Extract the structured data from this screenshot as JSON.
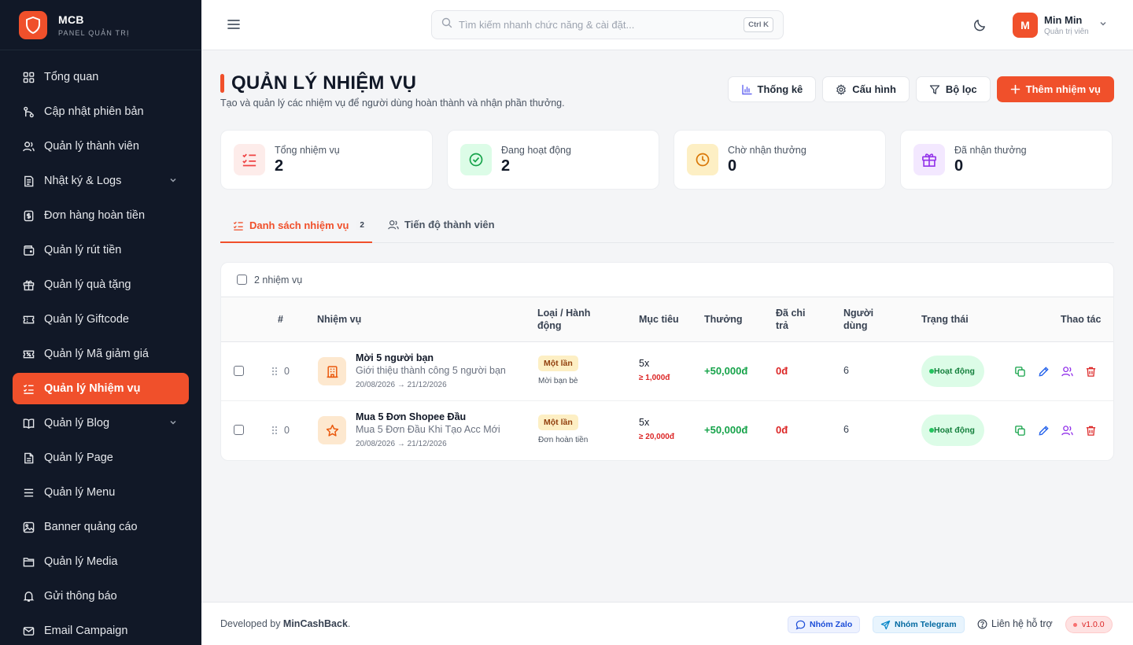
{
  "brand": {
    "name": "MCB",
    "subtitle": "PANEL QUẢN TRỊ"
  },
  "sidebar": {
    "items": [
      {
        "label": "Tổng quan",
        "icon": "grid-icon"
      },
      {
        "label": "Cập nhật phiên bản",
        "icon": "git-branch-icon"
      },
      {
        "label": "Quản lý thành viên",
        "icon": "users-icon"
      },
      {
        "label": "Nhật ký & Logs",
        "icon": "log-icon",
        "expandable": true
      },
      {
        "label": "Đơn hàng hoàn tiền",
        "icon": "receipt-icon"
      },
      {
        "label": "Quản lý rút tiền",
        "icon": "wallet-icon"
      },
      {
        "label": "Quản lý quà tặng",
        "icon": "gift-icon"
      },
      {
        "label": "Quản lý Giftcode",
        "icon": "ticket-icon"
      },
      {
        "label": "Quản lý Mã giảm giá",
        "icon": "coupon-icon"
      },
      {
        "label": "Quản lý Nhiệm vụ",
        "icon": "checklist-icon",
        "active": true
      },
      {
        "label": "Quản lý Blog",
        "icon": "book-icon",
        "expandable": true
      },
      {
        "label": "Quản lý Page",
        "icon": "file-icon"
      },
      {
        "label": "Quản lý Menu",
        "icon": "menu-icon"
      },
      {
        "label": "Banner quảng cáo",
        "icon": "image-icon"
      },
      {
        "label": "Quản lý Media",
        "icon": "folder-icon"
      },
      {
        "label": "Gửi thông báo",
        "icon": "bell-icon"
      },
      {
        "label": "Email Campaign",
        "icon": "mail-icon"
      }
    ]
  },
  "header": {
    "search_placeholder": "Tìm kiếm nhanh chức năng & cài đặt...",
    "shortcut": "Ctrl K",
    "user": {
      "initial": "M",
      "name": "Min Min",
      "role": "Quản trị viên"
    }
  },
  "page": {
    "title": "QUẢN LÝ NHIỆM VỤ",
    "subtitle": "Tạo và quản lý các nhiệm vụ để người dùng hoàn thành và nhận phần thưởng.",
    "actions": {
      "stats": "Thống kê",
      "config": "Cấu hình",
      "filter": "Bộ lọc",
      "add": "Thêm nhiệm vụ"
    }
  },
  "stats": [
    {
      "label": "Tổng nhiệm vụ",
      "value": "2",
      "color": "#ef4444",
      "bg": "#fdecea"
    },
    {
      "label": "Đang hoạt động",
      "value": "2",
      "color": "#16a34a",
      "bg": "#dcfce7"
    },
    {
      "label": "Chờ nhận thưởng",
      "value": "0",
      "color": "#d97706",
      "bg": "#fdefc4"
    },
    {
      "label": "Đã nhận thưởng",
      "value": "0",
      "color": "#9333ea",
      "bg": "#f3e8ff"
    }
  ],
  "tabs": [
    {
      "label": "Danh sách nhiệm vụ",
      "count": "2",
      "active": true
    },
    {
      "label": "Tiến độ thành viên"
    }
  ],
  "table": {
    "selection_label": "2 nhiệm vụ",
    "headers": {
      "index": "#",
      "task": "Nhiệm vụ",
      "type": "Loại / Hành động",
      "target": "Mục tiêu",
      "reward": "Thưởng",
      "paid": "Đã chi trả",
      "users": "Người dùng",
      "status": "Trạng thái",
      "actions": "Thao tác"
    },
    "rows": [
      {
        "order": "0",
        "icon": "building-icon",
        "name": "Mời 5 người bạn",
        "description": "Giới thiệu thành công 5 người bạn",
        "date": "20/08/2026 → 21/12/2026",
        "type": "Một lần",
        "action": "Mời bạn bè",
        "target": "5x",
        "target_min": "≥ 1,000đ",
        "reward": "+50,000đ",
        "paid": "0đ",
        "users": "6",
        "status": "Hoạt động"
      },
      {
        "order": "0",
        "icon": "star-icon",
        "name": "Mua 5 Đơn Shopee Đầu",
        "description": "Mua 5 Đơn Đầu Khi Tạo Acc Mới",
        "date": "20/08/2026 → 21/12/2026",
        "type": "Một lần",
        "action": "Đơn hoàn tiền",
        "target": "5x",
        "target_min": "≥ 20,000đ",
        "reward": "+50,000đ",
        "paid": "0đ",
        "users": "6",
        "status": "Hoạt động"
      }
    ]
  },
  "footer": {
    "dev_prefix": "Developed by ",
    "dev_name": "MinCashBack",
    "dev_suffix": ".",
    "zalo": "Nhóm Zalo",
    "telegram": "Nhóm Telegram",
    "support": "Liên hệ hỗ trợ",
    "version": "v1.0.0"
  },
  "colors": {
    "accent": "#f0502b",
    "sidebar_bg": "#111827"
  }
}
